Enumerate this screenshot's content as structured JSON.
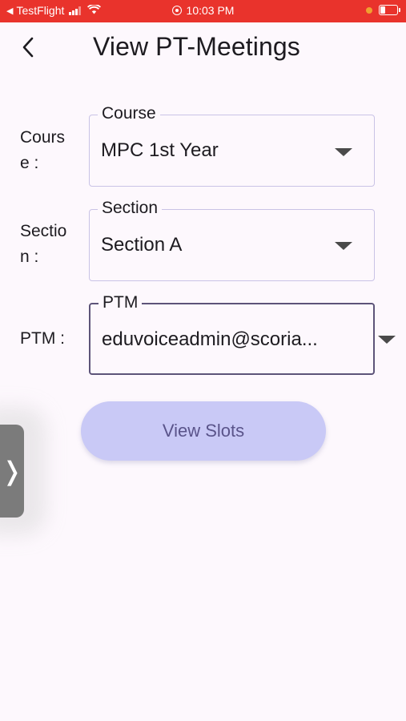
{
  "status_bar": {
    "back_app": "TestFlight",
    "time": "10:03 PM"
  },
  "header": {
    "title": "View PT-Meetings"
  },
  "form": {
    "course": {
      "label_line1": "Cours",
      "label_line2": "e :",
      "legend": "Course",
      "value": "MPC 1st Year"
    },
    "section": {
      "label_line1": "Sectio",
      "label_line2": "n :",
      "legend": "Section",
      "value": "Section A"
    },
    "ptm": {
      "label": "PTM :",
      "legend": "PTM",
      "value": "eduvoiceadmin@scoria..."
    }
  },
  "actions": {
    "view_slots_label": "View Slots"
  },
  "side_handle": {
    "glyph": "❭"
  },
  "colors": {
    "status_bar": "#e9332c",
    "background": "#fdf8fd",
    "field_border": "#c9c3e6",
    "field_border_focused": "#5d5479",
    "button_bg": "#c9c9f6",
    "button_text": "#5a548a"
  }
}
